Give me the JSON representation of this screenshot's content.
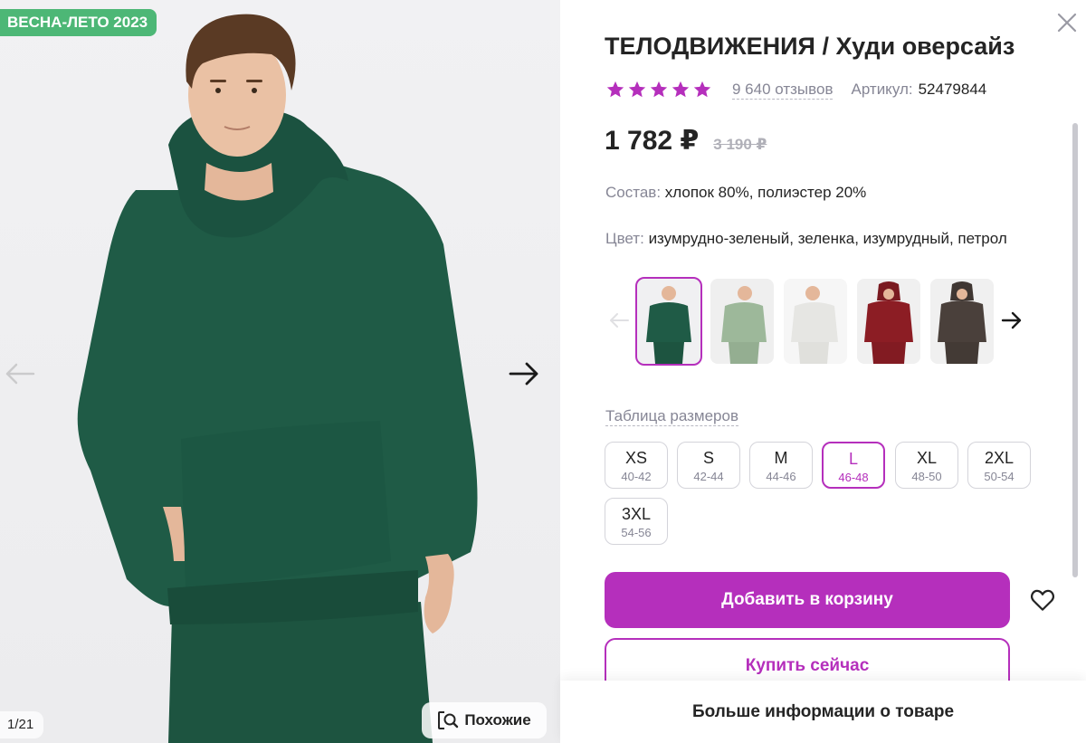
{
  "gallery": {
    "season_badge": "ВЕСНА-ЛЕТО 2023",
    "counter": "1/21",
    "similar_label": "Похожие",
    "prev_icon": "arrow-left-icon",
    "next_icon": "arrow-right-icon",
    "hoodie_color": "#1f5b46"
  },
  "product": {
    "title": "ТЕЛОДВИЖЕНИЯ / Худи оверсайз",
    "rating": 5,
    "reviews": "9 640 отзывов",
    "article_label": "Артикул:",
    "article_value": "52479844",
    "price": "1 782 ₽",
    "old_price": "3 190 ₽",
    "composition_label": "Состав:",
    "composition_value": "хлопок 80%, полиэстер 20%",
    "color_label": "Цвет:",
    "color_value": "изумрудно-зеленый, зеленка, изумрудный, петрол"
  },
  "color_variants": [
    {
      "name": "emerald",
      "hex": "#1f5b46",
      "active": true
    },
    {
      "name": "sage",
      "hex": "#9db89a",
      "active": false
    },
    {
      "name": "white",
      "hex": "#eeeeec",
      "active": false
    },
    {
      "name": "burgundy",
      "hex": "#8c1d24",
      "active": false
    },
    {
      "name": "graphite",
      "hex": "#4a403b",
      "active": false
    }
  ],
  "size_table_label": "Таблица размеров",
  "sizes": [
    {
      "name": "XS",
      "range": "40-42",
      "active": false
    },
    {
      "name": "S",
      "range": "42-44",
      "active": false
    },
    {
      "name": "M",
      "range": "44-46",
      "active": false
    },
    {
      "name": "L",
      "range": "46-48",
      "active": true
    },
    {
      "name": "XL",
      "range": "48-50",
      "active": false
    },
    {
      "name": "2XL",
      "range": "50-54",
      "active": false
    },
    {
      "name": "3XL",
      "range": "54-56",
      "active": false
    }
  ],
  "actions": {
    "add_to_cart": "Добавить в корзину",
    "buy_now": "Купить сейчас",
    "more_info": "Больше информации о товаре"
  },
  "colors": {
    "accent": "#b52fbc",
    "badge": "#4db776",
    "muted_text": "#868695"
  }
}
